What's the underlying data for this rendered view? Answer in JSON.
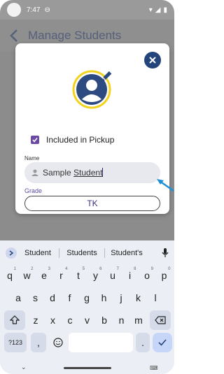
{
  "status_bar": {
    "time": "7:47"
  },
  "app_bar": {
    "title": "Manage Students"
  },
  "dialog": {
    "checkbox_label": "Included in Pickup",
    "checkbox_checked": true,
    "name_label": "Name",
    "name_value_plain": "Sample ",
    "name_value_underlined": "Student",
    "grade_label": "Grade",
    "grade_value": "TK"
  },
  "colors": {
    "accent": "#6a4aa5",
    "close_button": "#24447c",
    "avatar_ring": "#f3d21b",
    "arrow": "#1e90d8"
  },
  "keyboard": {
    "suggestions": [
      "Student",
      "Students",
      "Student's"
    ],
    "row1": [
      {
        "k": "q",
        "n": "1"
      },
      {
        "k": "w",
        "n": "2"
      },
      {
        "k": "e",
        "n": "3"
      },
      {
        "k": "r",
        "n": "4"
      },
      {
        "k": "t",
        "n": "5"
      },
      {
        "k": "y",
        "n": "6"
      },
      {
        "k": "u",
        "n": "7"
      },
      {
        "k": "i",
        "n": "8"
      },
      {
        "k": "o",
        "n": "9"
      },
      {
        "k": "p",
        "n": "0"
      }
    ],
    "row2": [
      "a",
      "s",
      "d",
      "f",
      "g",
      "h",
      "j",
      "k",
      "l"
    ],
    "row3": [
      "z",
      "x",
      "c",
      "v",
      "b",
      "n",
      "m"
    ],
    "symbols_key": "?123",
    "comma_key": ",",
    "period_key": "."
  }
}
